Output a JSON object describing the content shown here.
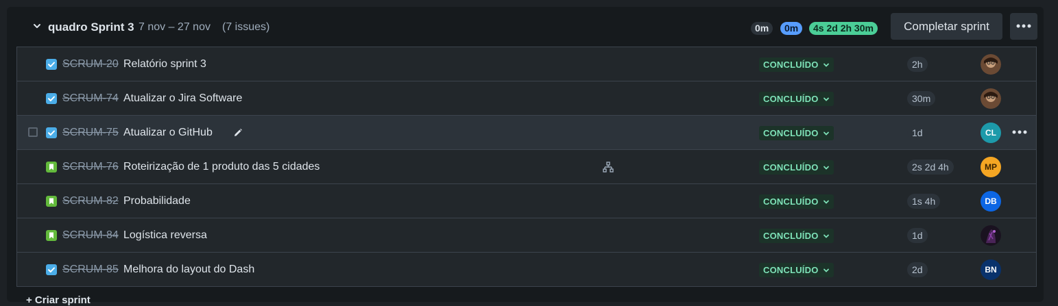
{
  "sprint": {
    "name": "quadro Sprint 3",
    "dates": "7 nov – 27 nov",
    "issue_count": "(7 issues)",
    "estimates": {
      "todo": "0m",
      "in_progress": "0m",
      "done": "4s 2d 2h 30m"
    },
    "complete_label": "Completar sprint",
    "colors": {
      "todo": "#2c333a",
      "in_progress": "#579dff",
      "done": "#4bce97"
    }
  },
  "issues": [
    {
      "type": "task-icon",
      "key": "SCRUM-20",
      "summary": "Relatório sprint 3",
      "status": "CONCLUÍDO",
      "estimate": "2h",
      "assignee_initials": "",
      "avatar": "photo"
    },
    {
      "type": "task-icon",
      "key": "SCRUM-74",
      "summary": "Atualizar o Jira Software",
      "status": "CONCLUÍDO",
      "estimate": "30m",
      "assignee_initials": "",
      "avatar": "photo"
    },
    {
      "type": "task-icon",
      "key": "SCRUM-75",
      "summary": "Atualizar o GitHub",
      "status": "CONCLUÍDO",
      "estimate": "1d",
      "assignee_initials": "CL",
      "avatar_color": "#1d9aaa"
    },
    {
      "type": "story-icon",
      "key": "SCRUM-76",
      "summary": "Roteirização de 1 produto das 5 cidades",
      "status": "CONCLUÍDO",
      "estimate": "2s 2d 4h",
      "assignee_initials": "MP",
      "avatar_color": "#f5a623"
    },
    {
      "type": "story-icon",
      "key": "SCRUM-82",
      "summary": "Probabilidade",
      "status": "CONCLUÍDO",
      "estimate": "1s 4h",
      "assignee_initials": "DB",
      "avatar_color": "#0c66e4"
    },
    {
      "type": "story-icon",
      "key": "SCRUM-84",
      "summary": "Logística reversa",
      "status": "CONCLUÍDO",
      "estimate": "1d",
      "assignee_initials": "",
      "avatar": "photo"
    },
    {
      "type": "task-icon",
      "key": "SCRUM-85",
      "summary": "Melhora do layout do Dash",
      "status": "CONCLUÍDO",
      "estimate": "2d",
      "assignee_initials": "BN",
      "avatar_color": "#09326c"
    }
  ],
  "footer": {
    "create_sprint": "+ Criar sprint"
  }
}
